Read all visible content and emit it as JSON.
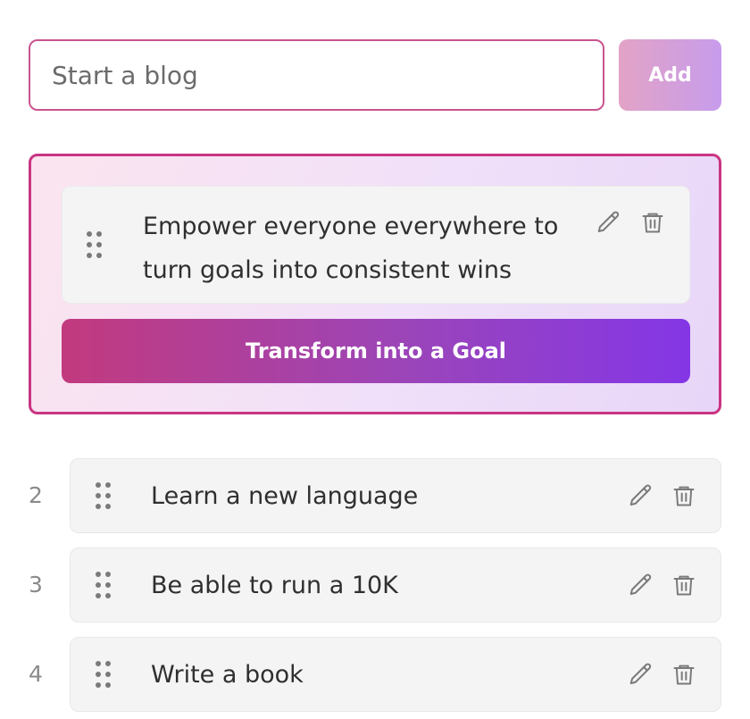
{
  "input": {
    "placeholder": "Start a blog",
    "value": ""
  },
  "add_button": {
    "label": "Add"
  },
  "featured": {
    "text": "Empower everyone everywhere to turn goals into consistent wins",
    "edit_icon": "pencil-icon",
    "delete_icon": "trash-icon",
    "transform_label": "Transform into a Goal"
  },
  "items": [
    {
      "number": "2",
      "text": "Learn a new language"
    },
    {
      "number": "3",
      "text": "Be able to run a 10K"
    },
    {
      "number": "4",
      "text": "Write a book"
    }
  ],
  "colors": {
    "accent_pink": "#c93582",
    "accent_purple": "#8436e6",
    "card_bg": "#f4f4f4",
    "icon": "#7a7a7a"
  }
}
